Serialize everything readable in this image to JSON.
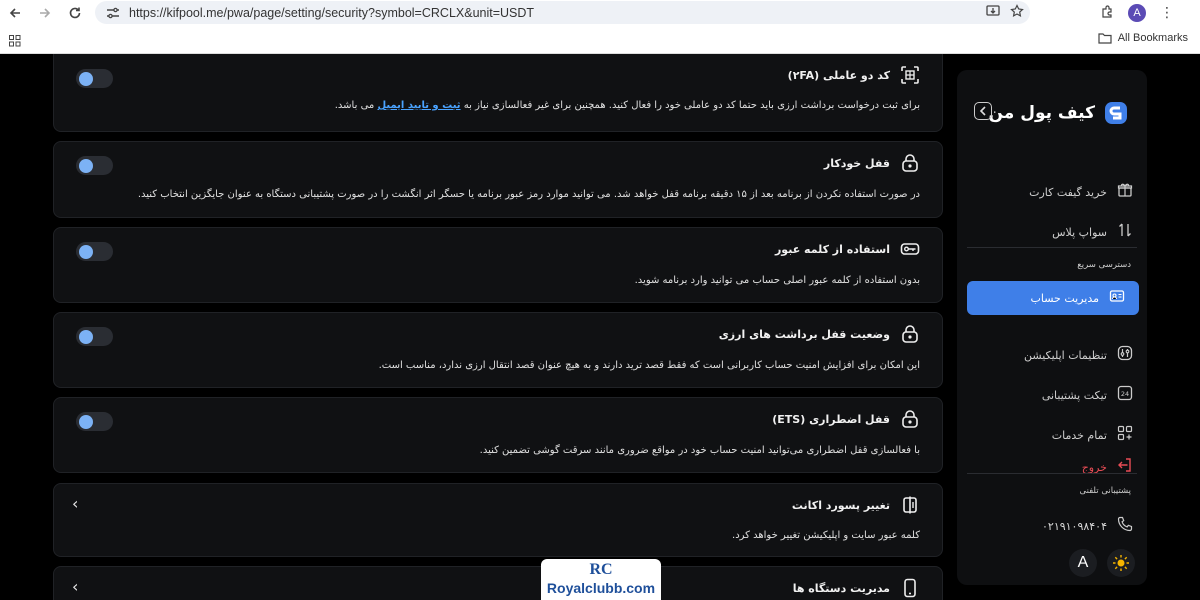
{
  "browser": {
    "url": "https://kifpool.me/pwa/page/setting/security?symbol=CRCLX&unit=USDT",
    "all_bookmarks": "All Bookmarks",
    "avatar_letter": "A"
  },
  "sidebar": {
    "brand": "کیف پول من",
    "items_top": [
      {
        "label": "خرید گیفت کارت",
        "icon": "gift-icon"
      },
      {
        "label": "سواپ پلاس",
        "icon": "swap-icon"
      }
    ],
    "quick_access_title": "دسترسی سریع",
    "active_item": {
      "label": "مدیریت حساب",
      "icon": "id-card-icon"
    },
    "items_quick": [
      {
        "label": "تنظیمات اپلیکیشن",
        "icon": "settings-icon"
      },
      {
        "label": "تیکت پشتیبانی",
        "icon": "ticket-icon"
      },
      {
        "label": "تمام خدمات",
        "icon": "grid-icon"
      }
    ],
    "logout": "خروج",
    "support_title": "پشتیبانی تلفنی",
    "phone": "۰۲۱۹۱۰۹۸۴۰۴",
    "theme_letter": "A",
    "accent_color": "#3f7fe8",
    "logout_color": "#e84c55"
  },
  "cards": [
    {
      "title": "کد دو عاملی (۲FA)",
      "icon": "qr-scan-icon",
      "desc_before": "برای ثبت درخواست برداشت ارزی باید حتما کد دو عاملی خود را فعال کنید. همچنین برای غیر فعالسازی نیاز به",
      "desc_link": "ثبت و تایید ایمیل",
      "desc_after": "می باشد.",
      "toggle_on": false
    },
    {
      "title": "قفل خودکار",
      "icon": "lock-icon",
      "desc": "در صورت استفاده نکردن از برنامه بعد از ۱۵ دقیقه برنامه قفل خواهد شد. می توانید موارد رمز عبور برنامه یا حسگر اثر انگشت را در صورت پشتیبانی دستگاه به عنوان جایگزین انتخاب کنید.",
      "toggle_on": false
    },
    {
      "title": "استفاده از کلمه عبور",
      "icon": "password-icon",
      "desc": "بدون استفاده از کلمه عبور اصلی حساب می توانید وارد برنامه شوید.",
      "toggle_on": false
    },
    {
      "title": "وضعیت قفل برداشت های ارزی",
      "icon": "lock-icon",
      "desc": "این امکان برای افزایش امنیت حساب کاربرانی است که فقط قصد ترید دارند و به هیچ عنوان قصد انتقال ارزی ندارد، مناسب است.",
      "toggle_on": false
    },
    {
      "title": "قفل اضطراری (ETS)",
      "icon": "lock-icon",
      "desc": "با فعالسازی قفل اضطراری می‌توانید امنیت حساب خود در مواقع ضروری مانند سرقت گوشی تضمین کنید.",
      "toggle_on": false
    },
    {
      "title": "تغییر پسورد اکانت",
      "icon": "password-change-icon",
      "desc": "کلمه عبور سایت و اپلیکیشن تغییر خواهد کرد."
    },
    {
      "title": "مدیریت دستگاه ها",
      "icon": "mobile-device-icon"
    }
  ],
  "watermark": {
    "logo": "RC",
    "text": "Royalclubb.com"
  }
}
